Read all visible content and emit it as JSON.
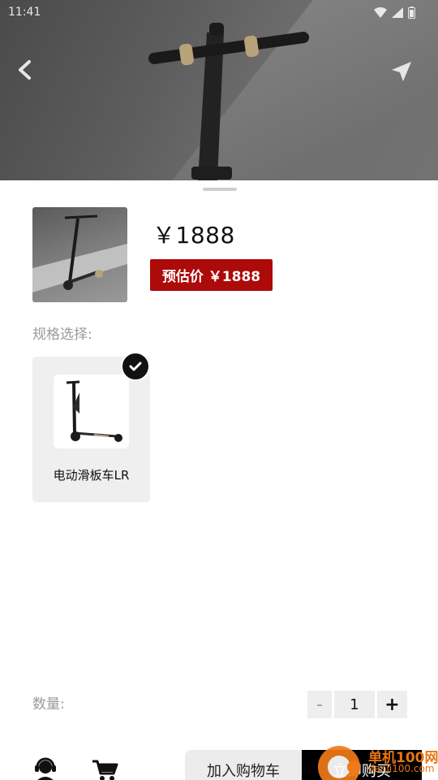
{
  "status_bar": {
    "time": "11:41"
  },
  "product": {
    "price": "￥1888",
    "estimated_price": "预估价 ￥1888"
  },
  "spec": {
    "label": "规格选择:",
    "options": [
      {
        "name": "电动滑板车LR",
        "selected": true
      }
    ]
  },
  "quantity": {
    "label": "数量:",
    "minus": "-",
    "value": "1",
    "plus": "+"
  },
  "actions": {
    "add_to_cart": "加入购物车",
    "buy_now": "立即购买"
  },
  "watermark": {
    "title": "单机100网",
    "url": "danji100.com"
  },
  "colors": {
    "badge_red": "#ad0a0a",
    "accent_black": "#000000",
    "card_bg": "#efefef"
  },
  "icons": [
    "back-arrow-icon",
    "share-arrow-icon",
    "customer-service-icon",
    "shopping-cart-icon",
    "checkmark-icon"
  ]
}
